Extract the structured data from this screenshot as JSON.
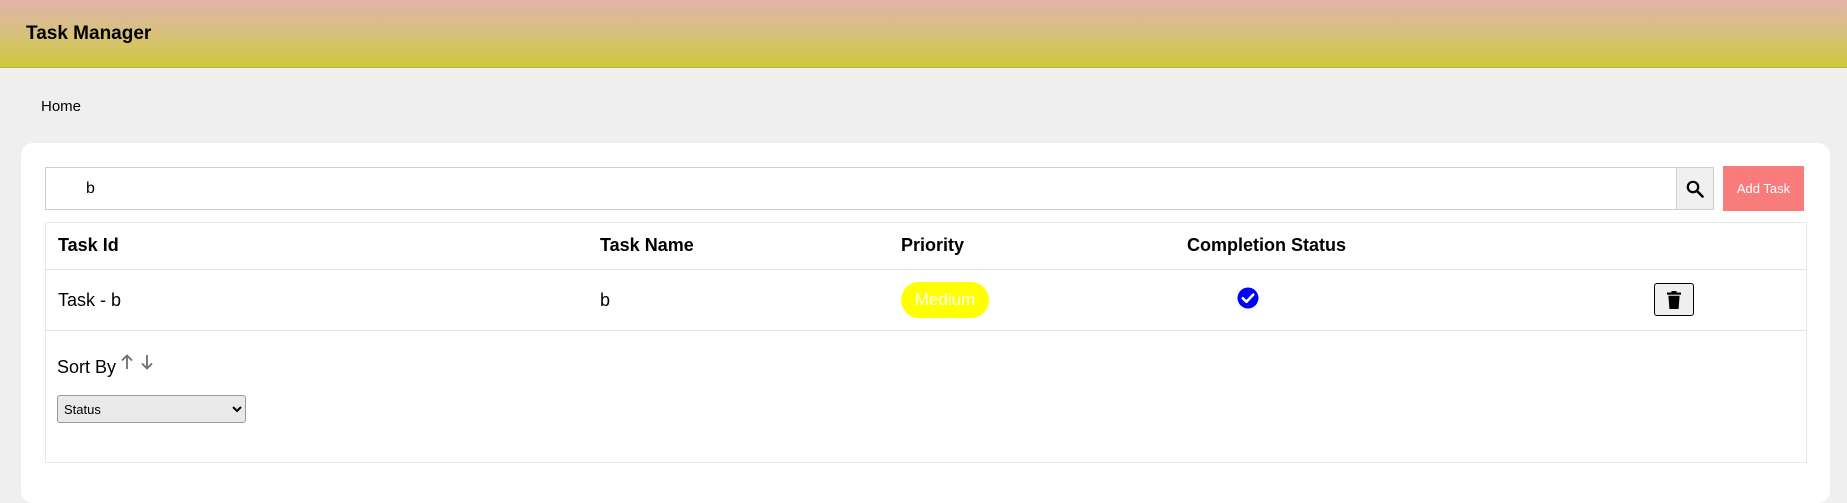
{
  "app": {
    "title": "Task Manager"
  },
  "breadcrumb": {
    "home": "Home"
  },
  "search": {
    "value": "b",
    "placeholder": ""
  },
  "toolbar": {
    "add_task_label": "Add Task"
  },
  "table": {
    "headers": {
      "task_id": "Task Id",
      "task_name": "Task Name",
      "priority": "Priority",
      "completion_status": "Completion Status"
    },
    "rows": [
      {
        "task_id": "Task - b",
        "task_name": "b",
        "priority": "Medium",
        "completed": true
      }
    ]
  },
  "sort": {
    "label": "Sort By",
    "selected": "Status",
    "options": [
      "Status"
    ]
  },
  "colors": {
    "header_gradient_top": "#e2b4a8",
    "header_gradient_bottom": "#cdc83c",
    "add_button": "#f97c7c",
    "priority_medium": "#ffff00",
    "status_check": "#0000ff"
  },
  "icons": {
    "search": "search-icon",
    "check": "check-circle-icon",
    "delete": "trash-icon",
    "sort_asc": "arrow-up-icon",
    "sort_desc": "arrow-down-icon"
  }
}
